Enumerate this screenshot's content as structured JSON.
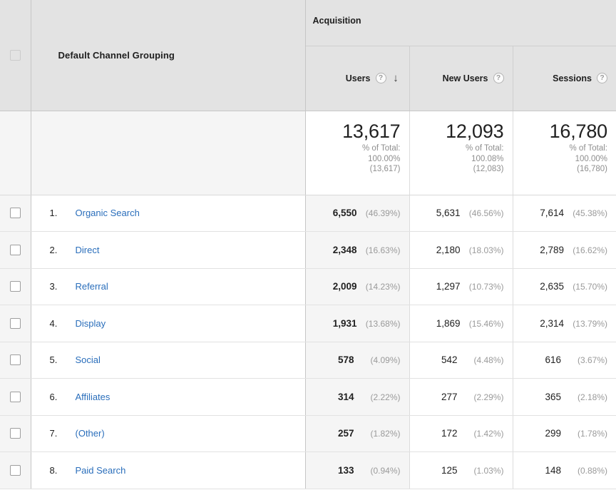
{
  "table": {
    "header": {
      "select_all_checkbox": "select-all",
      "dimension_label": "Default Channel Grouping",
      "group_label": "Acquisition",
      "metrics": [
        {
          "label": "Users",
          "help_icon": "help-question-icon",
          "sorted": true,
          "sort_icon": "arrow-down-icon"
        },
        {
          "label": "New Users",
          "help_icon": "help-question-icon",
          "sorted": false,
          "sort_icon": ""
        },
        {
          "label": "Sessions",
          "help_icon": "help-question-icon",
          "sorted": false,
          "sort_icon": ""
        }
      ]
    },
    "totals": [
      {
        "value": "13,617",
        "pct_of_total_label": "% of Total:",
        "pct": "100.00%",
        "absolute": "(13,617)"
      },
      {
        "value": "12,093",
        "pct_of_total_label": "% of Total:",
        "pct": "100.08%",
        "absolute": "(12,083)"
      },
      {
        "value": "16,780",
        "pct_of_total_label": "% of Total:",
        "pct": "100.00%",
        "absolute": "(16,780)"
      }
    ],
    "rows": [
      {
        "rank": "1.",
        "name": "Organic Search",
        "users": "6,550",
        "users_pct": "(46.39%)",
        "new_users": "5,631",
        "new_users_pct": "(46.56%)",
        "sessions": "7,614",
        "sessions_pct": "(45.38%)"
      },
      {
        "rank": "2.",
        "name": "Direct",
        "users": "2,348",
        "users_pct": "(16.63%)",
        "new_users": "2,180",
        "new_users_pct": "(18.03%)",
        "sessions": "2,789",
        "sessions_pct": "(16.62%)"
      },
      {
        "rank": "3.",
        "name": "Referral",
        "users": "2,009",
        "users_pct": "(14.23%)",
        "new_users": "1,297",
        "new_users_pct": "(10.73%)",
        "sessions": "2,635",
        "sessions_pct": "(15.70%)"
      },
      {
        "rank": "4.",
        "name": "Display",
        "users": "1,931",
        "users_pct": "(13.68%)",
        "new_users": "1,869",
        "new_users_pct": "(15.46%)",
        "sessions": "2,314",
        "sessions_pct": "(13.79%)"
      },
      {
        "rank": "5.",
        "name": "Social",
        "users": "578",
        "users_pct": "(4.09%)",
        "new_users": "542",
        "new_users_pct": "(4.48%)",
        "sessions": "616",
        "sessions_pct": "(3.67%)"
      },
      {
        "rank": "6.",
        "name": "Affiliates",
        "users": "314",
        "users_pct": "(2.22%)",
        "new_users": "277",
        "new_users_pct": "(2.29%)",
        "sessions": "365",
        "sessions_pct": "(2.18%)"
      },
      {
        "rank": "7.",
        "name": "(Other)",
        "users": "257",
        "users_pct": "(1.82%)",
        "new_users": "172",
        "new_users_pct": "(1.42%)",
        "sessions": "299",
        "sessions_pct": "(1.78%)"
      },
      {
        "rank": "8.",
        "name": "Paid Search",
        "users": "133",
        "users_pct": "(0.94%)",
        "new_users": "125",
        "new_users_pct": "(1.03%)",
        "sessions": "148",
        "sessions_pct": "(0.88%)"
      }
    ]
  },
  "icons": {
    "help": "?",
    "sort_down": "↓"
  },
  "colors": {
    "link": "#2a6ebb",
    "header_bg": "#e3e3e3",
    "sorted_col_bg": "#f5f5f5",
    "muted_text": "#9a9a9a"
  }
}
